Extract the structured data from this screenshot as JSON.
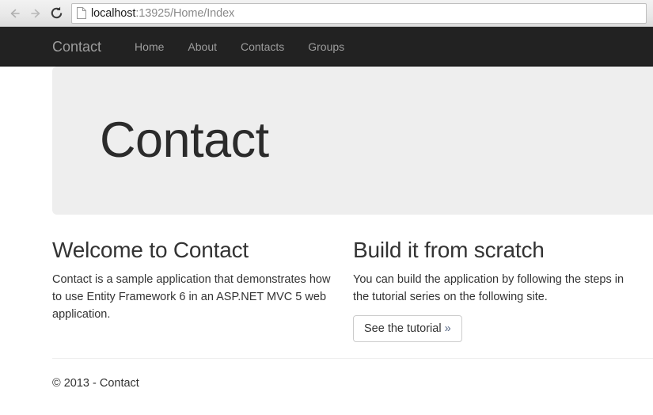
{
  "browser": {
    "back_icon": "arrow-left-icon",
    "forward_icon": "arrow-right-icon",
    "reload_icon": "reload-icon",
    "page_icon": "document-icon",
    "url_host": "localhost",
    "url_path": ":13925/Home/Index",
    "url_full": "localhost:13925/Home/Index"
  },
  "navbar": {
    "brand": "Contact",
    "links": [
      {
        "label": "Home"
      },
      {
        "label": "About"
      },
      {
        "label": "Contacts"
      },
      {
        "label": "Groups"
      }
    ],
    "background_color": "#222222",
    "link_color": "#9d9d9d"
  },
  "jumbotron": {
    "heading": "Contact",
    "background_color": "#eeeeee"
  },
  "main": {
    "columns": [
      {
        "heading": "Welcome to Contact",
        "body": "Contact is a sample application that demonstrates how to use Entity Framework 6 in an ASP.NET MVC 5 web application."
      },
      {
        "heading": "Build it from scratch",
        "body": "You can build the application by following the steps in the tutorial series on the following site.",
        "button_label": "See the tutorial",
        "button_arrow": "»"
      }
    ]
  },
  "footer": {
    "copyright": "© 2013 - Contact"
  }
}
